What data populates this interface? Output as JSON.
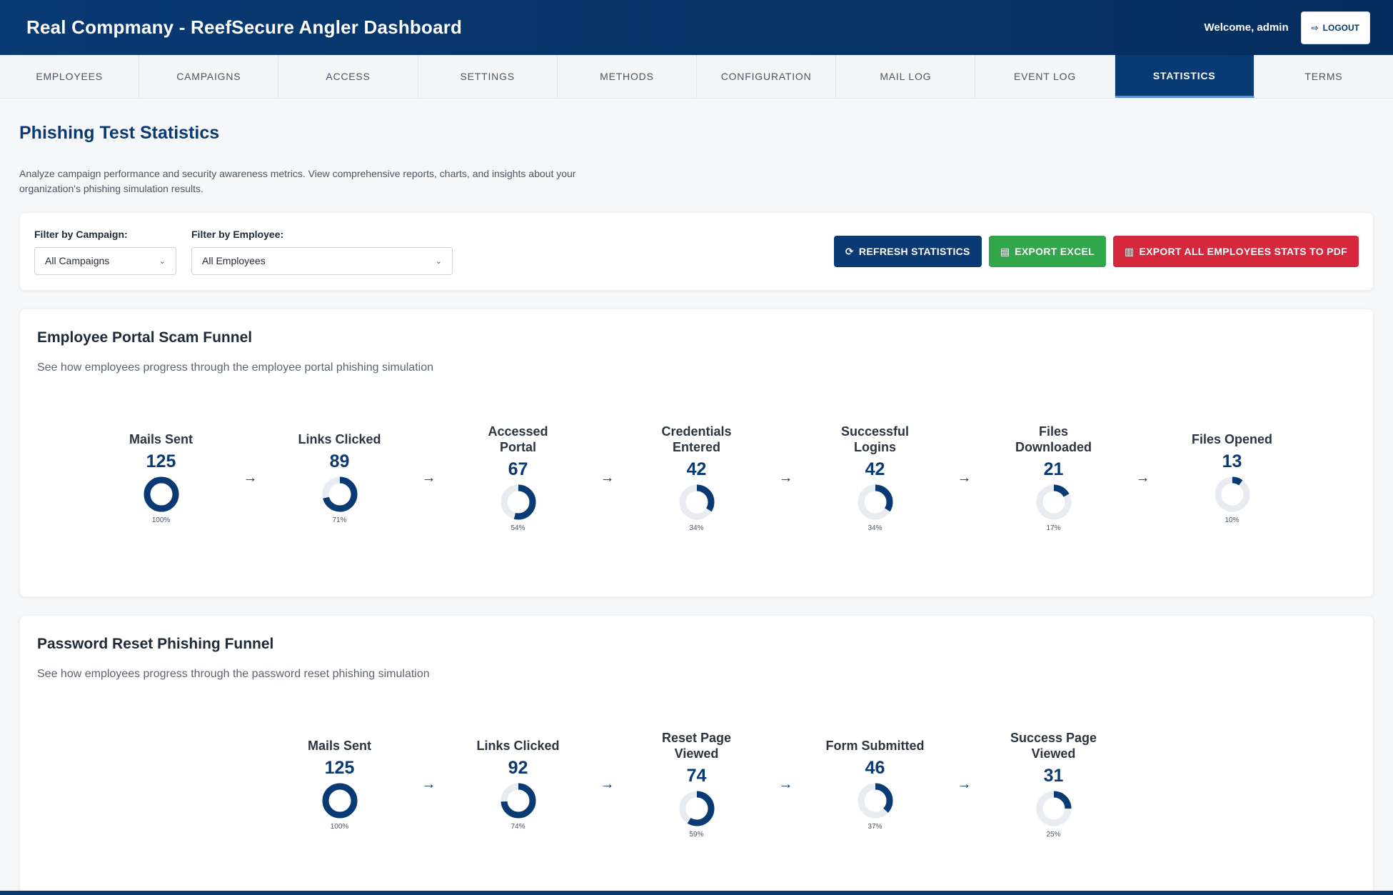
{
  "header": {
    "title": "Real Compmany - ReefSecure Angler Dashboard",
    "welcome": "Welcome, admin",
    "logout_label": "LOGOUT"
  },
  "nav": {
    "tabs": [
      {
        "label": "EMPLOYEES",
        "active": false
      },
      {
        "label": "CAMPAIGNS",
        "active": false
      },
      {
        "label": "ACCESS",
        "active": false
      },
      {
        "label": "SETTINGS",
        "active": false
      },
      {
        "label": "METHODS",
        "active": false
      },
      {
        "label": "CONFIGURATION",
        "active": false
      },
      {
        "label": "MAIL LOG",
        "active": false
      },
      {
        "label": "EVENT LOG",
        "active": false
      },
      {
        "label": "STATISTICS",
        "active": true
      },
      {
        "label": "TERMS",
        "active": false
      }
    ]
  },
  "page": {
    "title": "Phishing Test Statistics",
    "description": "Analyze campaign performance and security awareness metrics. View comprehensive reports, charts, and insights about your organization's phishing simulation results."
  },
  "filters": {
    "campaign_label": "Filter by Campaign:",
    "campaign_value": "All Campaigns",
    "employee_label": "Filter by Employee:",
    "employee_value": "All Employees"
  },
  "actions": {
    "refresh_label": "REFRESH STATISTICS",
    "excel_label": "EXPORT EXCEL",
    "pdf_label": "EXPORT ALL EMPLOYEES STATS TO PDF"
  },
  "colors": {
    "primary": "#0a3a73",
    "success": "#2fa74a",
    "danger": "#d6283d",
    "donut_track": "#e8ebef"
  },
  "funnels": [
    {
      "title": "Employee Portal Scam Funnel",
      "subtitle": "See how employees progress through the employee portal phishing simulation",
      "steps": [
        {
          "label": "Mails Sent",
          "value": "125",
          "pct": "100%",
          "fraction": 1.0
        },
        {
          "label": "Links Clicked",
          "value": "89",
          "pct": "71%",
          "fraction": 0.71
        },
        {
          "label": "Accessed Portal",
          "value": "67",
          "pct": "54%",
          "fraction": 0.54
        },
        {
          "label": "Credentials Entered",
          "value": "42",
          "pct": "34%",
          "fraction": 0.34
        },
        {
          "label": "Successful Logins",
          "value": "42",
          "pct": "34%",
          "fraction": 0.34
        },
        {
          "label": "Files Downloaded",
          "value": "21",
          "pct": "17%",
          "fraction": 0.17
        },
        {
          "label": "Files Opened",
          "value": "13",
          "pct": "10%",
          "fraction": 0.1
        }
      ]
    },
    {
      "title": "Password Reset Phishing Funnel",
      "subtitle": "See how employees progress through the password reset phishing simulation",
      "steps": [
        {
          "label": "Mails Sent",
          "value": "125",
          "pct": "100%",
          "fraction": 1.0
        },
        {
          "label": "Links Clicked",
          "value": "92",
          "pct": "74%",
          "fraction": 0.74
        },
        {
          "label": "Reset Page Viewed",
          "value": "74",
          "pct": "59%",
          "fraction": 0.59
        },
        {
          "label": "Form Submitted",
          "value": "46",
          "pct": "37%",
          "fraction": 0.37
        },
        {
          "label": "Success Page Viewed",
          "value": "31",
          "pct": "25%",
          "fraction": 0.25
        }
      ]
    }
  ],
  "icons": {
    "logout": "sign-out-icon",
    "refresh": "refresh-icon",
    "excel": "excel-file-icon",
    "pdf": "pdf-file-icon",
    "chevron": "chevron-down-icon",
    "arrow": "arrow-right-icon"
  }
}
